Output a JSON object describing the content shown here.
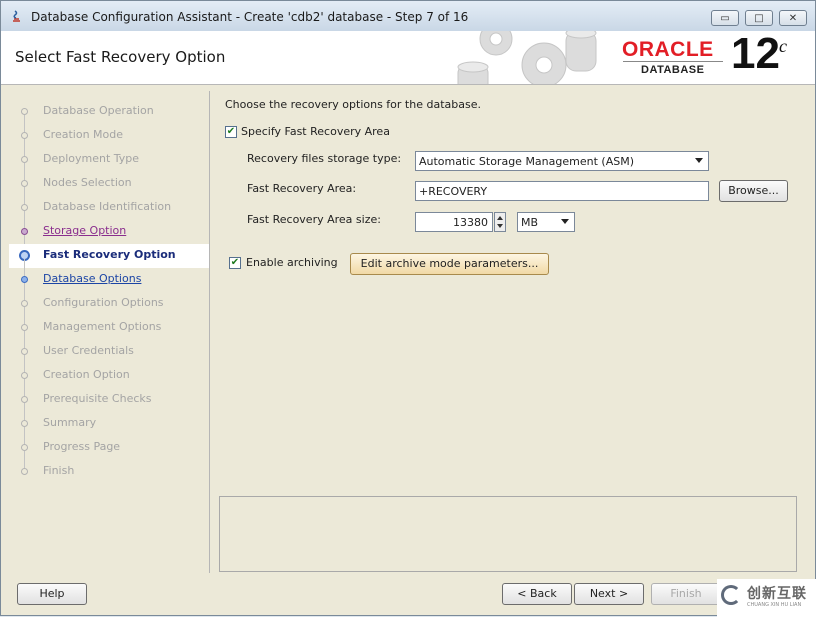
{
  "window": {
    "title": "Database Configuration Assistant - Create 'cdb2' database - Step 7 of 16",
    "minimize_glyph": "▭",
    "maximize_glyph": "□",
    "close_glyph": "✕"
  },
  "header": {
    "page_title": "Select Fast Recovery Option",
    "logo_brand": "ORACLE",
    "logo_product": "DATABASE",
    "logo_version": "12",
    "logo_version_suffix": "c",
    "icon": "gears-database-graphic"
  },
  "steps": [
    {
      "label": "Database Operation",
      "state": "disabled"
    },
    {
      "label": "Creation Mode",
      "state": "disabled"
    },
    {
      "label": "Deployment Type",
      "state": "disabled"
    },
    {
      "label": "Nodes Selection",
      "state": "disabled"
    },
    {
      "label": "Database Identification",
      "state": "disabled"
    },
    {
      "label": "Storage Option",
      "state": "done"
    },
    {
      "label": "Fast Recovery Option",
      "state": "current"
    },
    {
      "label": "Database Options",
      "state": "next"
    },
    {
      "label": "Configuration Options",
      "state": "disabled"
    },
    {
      "label": "Management Options",
      "state": "disabled"
    },
    {
      "label": "User Credentials",
      "state": "disabled"
    },
    {
      "label": "Creation Option",
      "state": "disabled"
    },
    {
      "label": "Prerequisite Checks",
      "state": "disabled"
    },
    {
      "label": "Summary",
      "state": "disabled"
    },
    {
      "label": "Progress Page",
      "state": "disabled"
    },
    {
      "label": "Finish",
      "state": "disabled"
    }
  ],
  "form": {
    "intro": "Choose the recovery options for the database.",
    "specify_fra_label": "Specify Fast Recovery Area",
    "specify_fra_checked": true,
    "storage_type_label": "Recovery files storage type:",
    "storage_type_value": "Automatic Storage Management (ASM)",
    "fra_label": "Fast Recovery Area:",
    "fra_value": "+RECOVERY",
    "browse_label": "Browse...",
    "fra_size_label": "Fast Recovery Area size:",
    "fra_size_value": "13380",
    "fra_size_unit": "MB",
    "enable_archiving_label": "Enable archiving",
    "enable_archiving_checked": true,
    "archive_params_label": "Edit archive mode parameters...",
    "check_glyph": "✔"
  },
  "footer": {
    "help_label": "Help",
    "back_label": "< Back",
    "next_label": "Next >",
    "finish_label": "Finish"
  },
  "watermark": {
    "name": "创新互联",
    "sub": "CHUANG XIN HU LIAN"
  },
  "colors": {
    "oracle_red": "#e21e26",
    "step_done": "#8a2e8e",
    "step_next": "#1c45a5",
    "step_current": "#1a2c7a"
  }
}
